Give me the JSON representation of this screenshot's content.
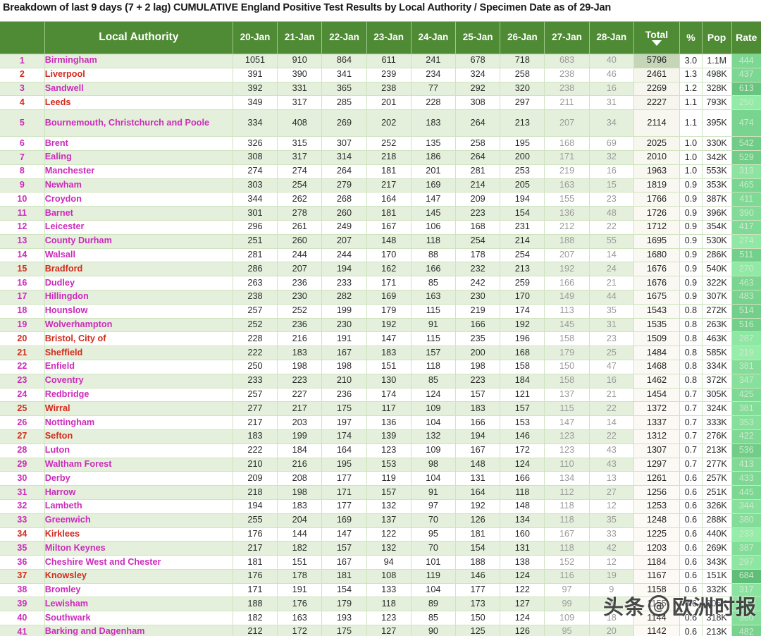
{
  "title": "Breakdown of last 9 days (7 + 2 lag) CUMULATIVE England Positive Test Results by Local Authority / Specimen Date as of 29-Jan",
  "header": {
    "rank": "",
    "local_authority": "Local Authority",
    "days": [
      "20-Jan",
      "21-Jan",
      "22-Jan",
      "23-Jan",
      "24-Jan",
      "25-Jan",
      "26-Jan",
      "27-Jan",
      "28-Jan"
    ],
    "total": "Total",
    "sort_indicator": "descending-sort-caret",
    "percent": "%",
    "pop": "Pop",
    "rate": "Rate"
  },
  "colors": {
    "header_green": "#4F8B35",
    "row_alt_green": "#e5f0dc",
    "name_magenta": "#CC2BBB",
    "name_red": "#D32B1E",
    "rate_green": "#6FE08B",
    "lag_gray": "#9a9a9a"
  },
  "watermark": {
    "text": "头条 @欧洲时报",
    "badge": "@"
  },
  "chart_data": {
    "type": "table",
    "title": "Breakdown of last 9 days (7 + 2 lag) CUMULATIVE England Positive Test Results by Local Authority / Specimen Date as of 29-Jan",
    "columns": [
      "Rank",
      "Local Authority",
      "20-Jan",
      "21-Jan",
      "22-Jan",
      "23-Jan",
      "24-Jan",
      "25-Jan",
      "26-Jan",
      "27-Jan",
      "28-Jan",
      "Total",
      "%",
      "Pop",
      "Rate"
    ],
    "lag_columns": [
      "27-Jan",
      "28-Jan"
    ],
    "sorted_by": "Total",
    "sort_order": "descending",
    "rows": [
      {
        "rank": 1,
        "name": "Birmingham",
        "color": "magenta",
        "d": [
          1051,
          910,
          864,
          611,
          241,
          678,
          718,
          683,
          40
        ],
        "total": 5796,
        "pct": "3.0",
        "pop": "1.1M",
        "rate": 444,
        "tall": false
      },
      {
        "rank": 2,
        "name": "Liverpool",
        "color": "red",
        "d": [
          391,
          390,
          341,
          239,
          234,
          324,
          258,
          238,
          46
        ],
        "total": 2461,
        "pct": "1.3",
        "pop": "498K",
        "rate": 437,
        "tall": false
      },
      {
        "rank": 3,
        "name": "Sandwell",
        "color": "magenta",
        "d": [
          392,
          331,
          365,
          238,
          77,
          292,
          320,
          238,
          16
        ],
        "total": 2269,
        "pct": "1.2",
        "pop": "328K",
        "rate": 613,
        "tall": false
      },
      {
        "rank": 4,
        "name": "Leeds",
        "color": "red",
        "d": [
          349,
          317,
          285,
          201,
          228,
          308,
          297,
          211,
          31
        ],
        "total": 2227,
        "pct": "1.1",
        "pop": "793K",
        "rate": 250,
        "tall": false
      },
      {
        "rank": 5,
        "name": "Bournemouth, Christchurch and Poole",
        "color": "magenta",
        "d": [
          334,
          408,
          269,
          202,
          183,
          264,
          213,
          207,
          34
        ],
        "total": 2114,
        "pct": "1.1",
        "pop": "395K",
        "rate": 474,
        "tall": true
      },
      {
        "rank": 6,
        "name": "Brent",
        "color": "magenta",
        "d": [
          326,
          315,
          307,
          252,
          135,
          258,
          195,
          168,
          69
        ],
        "total": 2025,
        "pct": "1.0",
        "pop": "330K",
        "rate": 542,
        "tall": false
      },
      {
        "rank": 7,
        "name": "Ealing",
        "color": "magenta",
        "d": [
          308,
          317,
          314,
          218,
          186,
          264,
          200,
          171,
          32
        ],
        "total": 2010,
        "pct": "1.0",
        "pop": "342K",
        "rate": 529,
        "tall": false
      },
      {
        "rank": 8,
        "name": "Manchester",
        "color": "magenta",
        "d": [
          274,
          274,
          264,
          181,
          201,
          281,
          253,
          219,
          16
        ],
        "total": 1963,
        "pct": "1.0",
        "pop": "553K",
        "rate": 313,
        "tall": false
      },
      {
        "rank": 9,
        "name": "Newham",
        "color": "magenta",
        "d": [
          303,
          254,
          279,
          217,
          169,
          214,
          205,
          163,
          15
        ],
        "total": 1819,
        "pct": "0.9",
        "pop": "353K",
        "rate": 465,
        "tall": false
      },
      {
        "rank": 10,
        "name": "Croydon",
        "color": "magenta",
        "d": [
          344,
          262,
          268,
          164,
          147,
          209,
          194,
          155,
          23
        ],
        "total": 1766,
        "pct": "0.9",
        "pop": "387K",
        "rate": 411,
        "tall": false
      },
      {
        "rank": 11,
        "name": "Barnet",
        "color": "magenta",
        "d": [
          301,
          278,
          260,
          181,
          145,
          223,
          154,
          136,
          48
        ],
        "total": 1726,
        "pct": "0.9",
        "pop": "396K",
        "rate": 390,
        "tall": false
      },
      {
        "rank": 12,
        "name": "Leicester",
        "color": "magenta",
        "d": [
          296,
          261,
          249,
          167,
          106,
          168,
          231,
          212,
          22
        ],
        "total": 1712,
        "pct": "0.9",
        "pop": "354K",
        "rate": 417,
        "tall": false
      },
      {
        "rank": 13,
        "name": "County Durham",
        "color": "magenta",
        "d": [
          251,
          260,
          207,
          148,
          118,
          254,
          214,
          188,
          55
        ],
        "total": 1695,
        "pct": "0.9",
        "pop": "530K",
        "rate": 274,
        "tall": false
      },
      {
        "rank": 14,
        "name": "Walsall",
        "color": "magenta",
        "d": [
          281,
          244,
          244,
          170,
          88,
          178,
          254,
          207,
          14
        ],
        "total": 1680,
        "pct": "0.9",
        "pop": "286K",
        "rate": 511,
        "tall": false
      },
      {
        "rank": 15,
        "name": "Bradford",
        "color": "red",
        "d": [
          286,
          207,
          194,
          162,
          166,
          232,
          213,
          192,
          24
        ],
        "total": 1676,
        "pct": "0.9",
        "pop": "540K",
        "rate": 270,
        "tall": false
      },
      {
        "rank": 16,
        "name": "Dudley",
        "color": "magenta",
        "d": [
          263,
          236,
          233,
          171,
          85,
          242,
          259,
          166,
          21
        ],
        "total": 1676,
        "pct": "0.9",
        "pop": "322K",
        "rate": 463,
        "tall": false
      },
      {
        "rank": 17,
        "name": "Hillingdon",
        "color": "magenta",
        "d": [
          238,
          230,
          282,
          169,
          163,
          230,
          170,
          149,
          44
        ],
        "total": 1675,
        "pct": "0.9",
        "pop": "307K",
        "rate": 483,
        "tall": false
      },
      {
        "rank": 18,
        "name": "Hounslow",
        "color": "magenta",
        "d": [
          257,
          252,
          199,
          179,
          115,
          219,
          174,
          113,
          35
        ],
        "total": 1543,
        "pct": "0.8",
        "pop": "272K",
        "rate": 514,
        "tall": false
      },
      {
        "rank": 19,
        "name": "Wolverhampton",
        "color": "magenta",
        "d": [
          252,
          236,
          230,
          192,
          91,
          166,
          192,
          145,
          31
        ],
        "total": 1535,
        "pct": "0.8",
        "pop": "263K",
        "rate": 516,
        "tall": false
      },
      {
        "rank": 20,
        "name": "Bristol, City of",
        "color": "red",
        "d": [
          228,
          216,
          191,
          147,
          115,
          235,
          196,
          158,
          23
        ],
        "total": 1509,
        "pct": "0.8",
        "pop": "463K",
        "rate": 287,
        "tall": false
      },
      {
        "rank": 21,
        "name": "Sheffield",
        "color": "red",
        "d": [
          222,
          183,
          167,
          183,
          157,
          200,
          168,
          179,
          25
        ],
        "total": 1484,
        "pct": "0.8",
        "pop": "585K",
        "rate": 219,
        "tall": false
      },
      {
        "rank": 22,
        "name": "Enfield",
        "color": "magenta",
        "d": [
          250,
          198,
          198,
          151,
          118,
          198,
          158,
          150,
          47
        ],
        "total": 1468,
        "pct": "0.8",
        "pop": "334K",
        "rate": 381,
        "tall": false
      },
      {
        "rank": 23,
        "name": "Coventry",
        "color": "magenta",
        "d": [
          233,
          223,
          210,
          130,
          85,
          223,
          184,
          158,
          16
        ],
        "total": 1462,
        "pct": "0.8",
        "pop": "372K",
        "rate": 347,
        "tall": false
      },
      {
        "rank": 24,
        "name": "Redbridge",
        "color": "magenta",
        "d": [
          257,
          227,
          236,
          174,
          124,
          157,
          121,
          137,
          21
        ],
        "total": 1454,
        "pct": "0.7",
        "pop": "305K",
        "rate": 425,
        "tall": false
      },
      {
        "rank": 25,
        "name": "Wirral",
        "color": "red",
        "d": [
          277,
          217,
          175,
          117,
          109,
          183,
          157,
          115,
          22
        ],
        "total": 1372,
        "pct": "0.7",
        "pop": "324K",
        "rate": 381,
        "tall": false
      },
      {
        "rank": 26,
        "name": "Nottingham",
        "color": "magenta",
        "d": [
          217,
          203,
          197,
          136,
          104,
          166,
          153,
          147,
          14
        ],
        "total": 1337,
        "pct": "0.7",
        "pop": "333K",
        "rate": 353,
        "tall": false
      },
      {
        "rank": 27,
        "name": "Sefton",
        "color": "red",
        "d": [
          183,
          199,
          174,
          139,
          132,
          194,
          146,
          123,
          22
        ],
        "total": 1312,
        "pct": "0.7",
        "pop": "276K",
        "rate": 422,
        "tall": false
      },
      {
        "rank": 28,
        "name": "Luton",
        "color": "magenta",
        "d": [
          222,
          184,
          164,
          123,
          109,
          167,
          172,
          123,
          43
        ],
        "total": 1307,
        "pct": "0.7",
        "pop": "213K",
        "rate": 536,
        "tall": false
      },
      {
        "rank": 29,
        "name": "Waltham Forest",
        "color": "magenta",
        "d": [
          210,
          216,
          195,
          153,
          98,
          148,
          124,
          110,
          43
        ],
        "total": 1297,
        "pct": "0.7",
        "pop": "277K",
        "rate": 413,
        "tall": false
      },
      {
        "rank": 30,
        "name": "Derby",
        "color": "magenta",
        "d": [
          209,
          208,
          177,
          119,
          104,
          131,
          166,
          134,
          13
        ],
        "total": 1261,
        "pct": "0.6",
        "pop": "257K",
        "rate": 433,
        "tall": false
      },
      {
        "rank": 31,
        "name": "Harrow",
        "color": "magenta",
        "d": [
          218,
          198,
          171,
          157,
          91,
          164,
          118,
          112,
          27
        ],
        "total": 1256,
        "pct": "0.6",
        "pop": "251K",
        "rate": 445,
        "tall": false
      },
      {
        "rank": 32,
        "name": "Lambeth",
        "color": "magenta",
        "d": [
          194,
          183,
          177,
          132,
          97,
          192,
          148,
          118,
          12
        ],
        "total": 1253,
        "pct": "0.6",
        "pop": "326K",
        "rate": 344,
        "tall": false
      },
      {
        "rank": 33,
        "name": "Greenwich",
        "color": "magenta",
        "d": [
          255,
          204,
          169,
          137,
          70,
          126,
          134,
          118,
          35
        ],
        "total": 1248,
        "pct": "0.6",
        "pop": "288K",
        "rate": 380,
        "tall": false
      },
      {
        "rank": 34,
        "name": "Kirklees",
        "color": "red",
        "d": [
          176,
          144,
          147,
          122,
          95,
          181,
          160,
          167,
          33
        ],
        "total": 1225,
        "pct": "0.6",
        "pop": "440K",
        "rate": 233,
        "tall": false
      },
      {
        "rank": 35,
        "name": "Milton Keynes",
        "color": "magenta",
        "d": [
          217,
          182,
          157,
          132,
          70,
          154,
          131,
          118,
          42
        ],
        "total": 1203,
        "pct": "0.6",
        "pop": "269K",
        "rate": 387,
        "tall": false
      },
      {
        "rank": 36,
        "name": "Cheshire West and Chester",
        "color": "magenta",
        "d": [
          181,
          151,
          167,
          94,
          101,
          188,
          138,
          152,
          12
        ],
        "total": 1184,
        "pct": "0.6",
        "pop": "343K",
        "rate": 297,
        "tall": false
      },
      {
        "rank": 37,
        "name": "Knowsley",
        "color": "red",
        "d": [
          176,
          178,
          181,
          108,
          119,
          146,
          124,
          116,
          19
        ],
        "total": 1167,
        "pct": "0.6",
        "pop": "151K",
        "rate": 684,
        "tall": false
      },
      {
        "rank": 38,
        "name": "Bromley",
        "color": "magenta",
        "d": [
          171,
          191,
          154,
          133,
          104,
          177,
          122,
          97,
          9
        ],
        "total": 1158,
        "pct": "0.6",
        "pop": "332K",
        "rate": 317,
        "tall": false
      },
      {
        "rank": 39,
        "name": "Lewisham",
        "color": "magenta",
        "d": [
          188,
          176,
          179,
          118,
          89,
          173,
          127,
          99,
          5
        ],
        "total": 1155,
        "pct": "0.6",
        "pop": "305K",
        "rate": 343,
        "tall": false
      },
      {
        "rank": 40,
        "name": "Southwark",
        "color": "magenta",
        "d": [
          182,
          163,
          193,
          123,
          85,
          150,
          124,
          109,
          18
        ],
        "total": 1144,
        "pct": "0.6",
        "pop": "318K",
        "rate": 360,
        "tall": false
      },
      {
        "rank": 41,
        "name": "Barking and Dagenham",
        "color": "magenta",
        "d": [
          212,
          172,
          175,
          127,
          90,
          125,
          126,
          95,
          20
        ],
        "total": 1142,
        "pct": "0.6",
        "pop": "213K",
        "rate": 482,
        "tall": false
      }
    ]
  }
}
